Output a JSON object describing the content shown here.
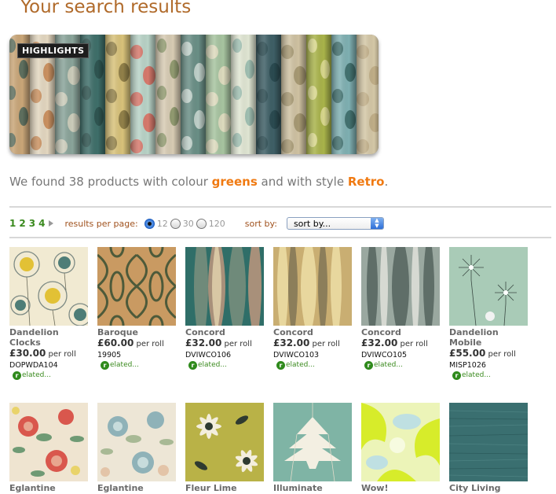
{
  "page": {
    "title": "Your search results"
  },
  "banner": {
    "badge": "HIGHLIGHTS"
  },
  "summary": {
    "prefix": "We found 38 products with colour ",
    "colour": "greens",
    "middle": " and with style ",
    "style": "Retro",
    "suffix": "."
  },
  "pagination": {
    "pages": [
      "1",
      "2",
      "3",
      "4"
    ]
  },
  "results_per_page": {
    "label": "results per page:",
    "options": [
      "12",
      "30",
      "120"
    ],
    "selected": "12"
  },
  "sort": {
    "label": "sort by:",
    "value": "sort by..."
  },
  "products": [
    {
      "name": "Dandelion Clocks",
      "price": "£30.00",
      "per": " per roll",
      "code": "DOPWDA104",
      "related": "elated..."
    },
    {
      "name": "Baroque",
      "price": "£60.00",
      "per": " per roll",
      "code": "19905",
      "related": "elated..."
    },
    {
      "name": "Concord",
      "price": "£32.00",
      "per": " per roll",
      "code": "DVIWCO106",
      "related": "elated..."
    },
    {
      "name": "Concord",
      "price": "£32.00",
      "per": " per roll",
      "code": "DVIWCO103",
      "related": "elated..."
    },
    {
      "name": "Concord",
      "price": "£32.00",
      "per": " per roll",
      "code": "DVIWCO105",
      "related": "elated..."
    },
    {
      "name": "Dandelion Mobile",
      "price": "£55.00",
      "per": " per roll",
      "code": "MISP1026",
      "related": "elated..."
    },
    {
      "name": "Eglantine"
    },
    {
      "name": "Eglantine"
    },
    {
      "name": "Fleur Lime"
    },
    {
      "name": "Illuminate"
    },
    {
      "name": "Wow!"
    },
    {
      "name": "City Living"
    }
  ],
  "colors": {
    "title": "#b06a2a",
    "highlight": "#f07a12",
    "link_green": "#3a8a1e"
  }
}
